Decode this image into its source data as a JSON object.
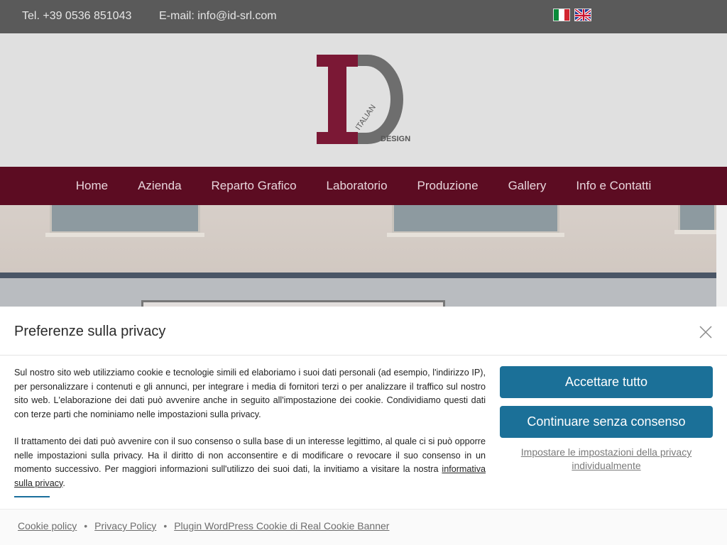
{
  "topbar": {
    "tel": "Tel.  +39 0536 851043",
    "email": "E-mail: info@id-srl.com",
    "flags": [
      "flag-it-icon",
      "flag-uk-icon"
    ]
  },
  "logo": {
    "word_italian": "ITALIAN",
    "word_design": "DESIGN",
    "colors": {
      "maroon": "#7b1835",
      "gray": "#6e6e6e"
    }
  },
  "nav": {
    "items": [
      "Home",
      "Azienda",
      "Reparto Grafico",
      "Laboratorio",
      "Produzione",
      "Gallery",
      "Info e Contatti"
    ]
  },
  "banner": {
    "title": "Preferenze sulla privacy",
    "paragraph1": "Sul nostro sito web utilizziamo cookie e tecnologie simili ed elaboriamo i suoi dati personali (ad esempio, l'indirizzo IP), per personalizzare i contenuti e gli annunci, per integrare i media di fornitori terzi o per analizzare il traffico sul nostro sito web. L'elaborazione dei dati può avvenire anche in seguito all'impostazione dei cookie. Condividiamo questi dati con terze parti che nominiamo nelle impostazioni sulla privacy.",
    "paragraph2_lead": "Il trattamento dei dati può avvenire con il suo consenso o sulla base di un interesse legittimo, al quale ci si può opporre nelle impostazioni sulla privacy. Ha il diritto di non acconsentire e di modificare o revocare il suo consenso in un momento successivo. Per maggiori informazioni sull'utilizzo dei suoi dati, la invitiamo a visitare la nostra",
    "paragraph2_link": "informativa sulla privacy",
    "paragraph2_end": ".",
    "accept_label": "Accettare tutto",
    "continue_label": "Continuare senza consenso",
    "individual_label": "Impostare le impostazioni della privacy individualmente",
    "accent_color": "#1b7098"
  },
  "footer": {
    "links": [
      "Cookie policy",
      "Privacy Policy",
      "Plugin WordPress Cookie di Real Cookie Banner"
    ],
    "separator": "•"
  }
}
